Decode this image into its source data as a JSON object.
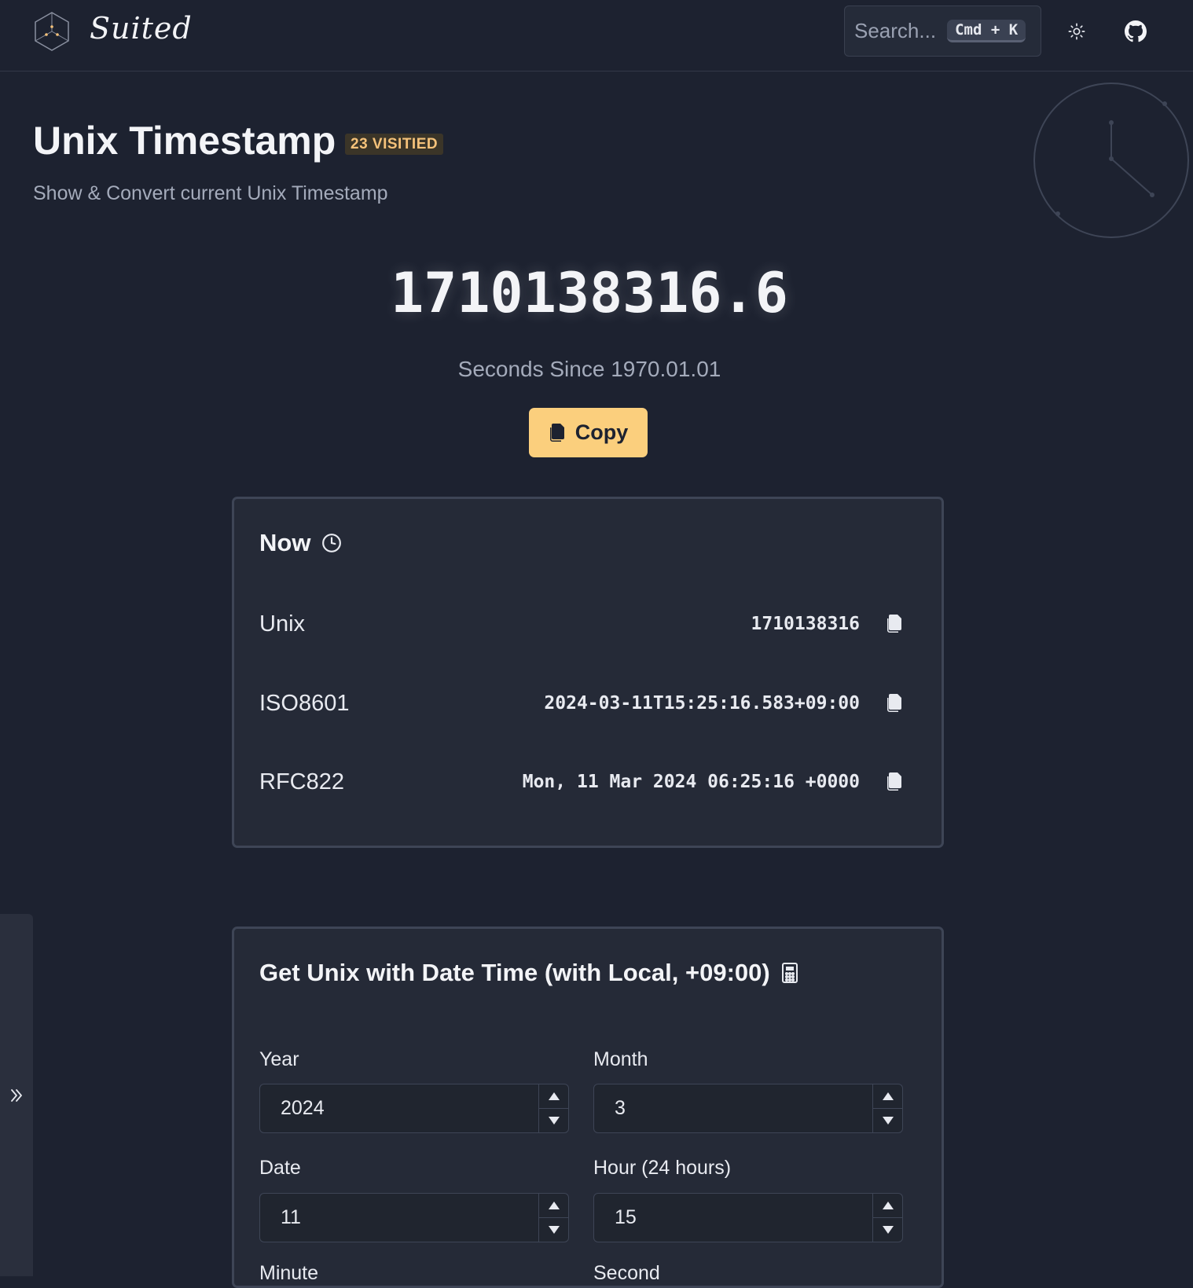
{
  "header": {
    "brand": "Suited",
    "search_placeholder": "Search...",
    "search_shortcut": "Cmd + K",
    "theme_icon": "sun-icon",
    "github_icon": "github-icon"
  },
  "page": {
    "title": "Unix Timestamp",
    "visited_badge": "23 VISITIED",
    "subtitle": "Show & Convert current Unix Timestamp"
  },
  "hero": {
    "timestamp": "1710138316.6",
    "since_label": "Seconds Since 1970.01.01",
    "copy_label": "Copy"
  },
  "now_card": {
    "title": "Now",
    "rows": [
      {
        "label": "Unix",
        "value": "1710138316"
      },
      {
        "label": "ISO8601",
        "value": "2024-03-11T15:25:16.583+09:00"
      },
      {
        "label": "RFC822",
        "value": "Mon, 11 Mar 2024 06:25:16 +0000"
      }
    ]
  },
  "get_card": {
    "title": "Get Unix with Date Time (with Local, +09:00)",
    "fields": {
      "year": {
        "label": "Year",
        "value": "2024"
      },
      "month": {
        "label": "Month",
        "value": "3"
      },
      "date": {
        "label": "Date",
        "value": "11"
      },
      "hour": {
        "label": "Hour (24 hours)",
        "value": "15"
      },
      "minute": {
        "label": "Minute"
      },
      "second": {
        "label": "Second"
      }
    }
  },
  "colors": {
    "background": "#1d2230",
    "card": "#252a37",
    "accent": "#fbcf7d",
    "badge_text": "#f5c27a"
  }
}
